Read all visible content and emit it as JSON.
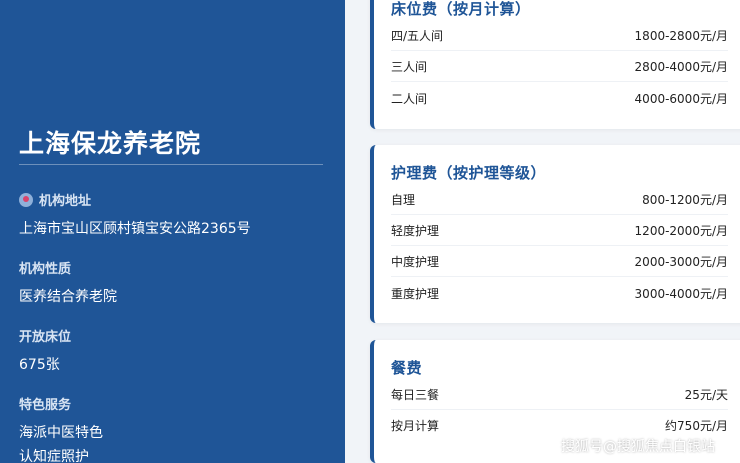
{
  "sidebar": {
    "title": "上海保龙养老院",
    "fields": [
      {
        "label": "机构地址",
        "value": "上海市宝山区顾村镇宝安公路2365号"
      },
      {
        "label": "机构性质",
        "value": "医养结合养老院"
      },
      {
        "label": "开放床位",
        "value": "675张"
      },
      {
        "label": "特色服务",
        "value": "海派中医特色",
        "value2": "认知症照护"
      }
    ]
  },
  "cards": {
    "bed": {
      "title": "床位费（按月计算）",
      "rows": [
        {
          "name": "四/五人间",
          "price": "1800-2800元/月"
        },
        {
          "name": "三人间",
          "price": "2800-4000元/月"
        },
        {
          "name": "二人间",
          "price": "4000-6000元/月"
        }
      ]
    },
    "care": {
      "title": "护理费（按护理等级）",
      "rows": [
        {
          "name": "自理",
          "price": "800-1200元/月"
        },
        {
          "name": "轻度护理",
          "price": "1200-2000元/月"
        },
        {
          "name": "中度护理",
          "price": "2000-3000元/月"
        },
        {
          "name": "重度护理",
          "price": "3000-4000元/月"
        }
      ]
    },
    "meal": {
      "title": "餐费",
      "rows": [
        {
          "name": "每日三餐",
          "price": "25元/天"
        },
        {
          "name": "按月计算",
          "price": "约750元/月"
        }
      ]
    }
  },
  "watermark": "搜狐号@搜狐焦点白银站"
}
